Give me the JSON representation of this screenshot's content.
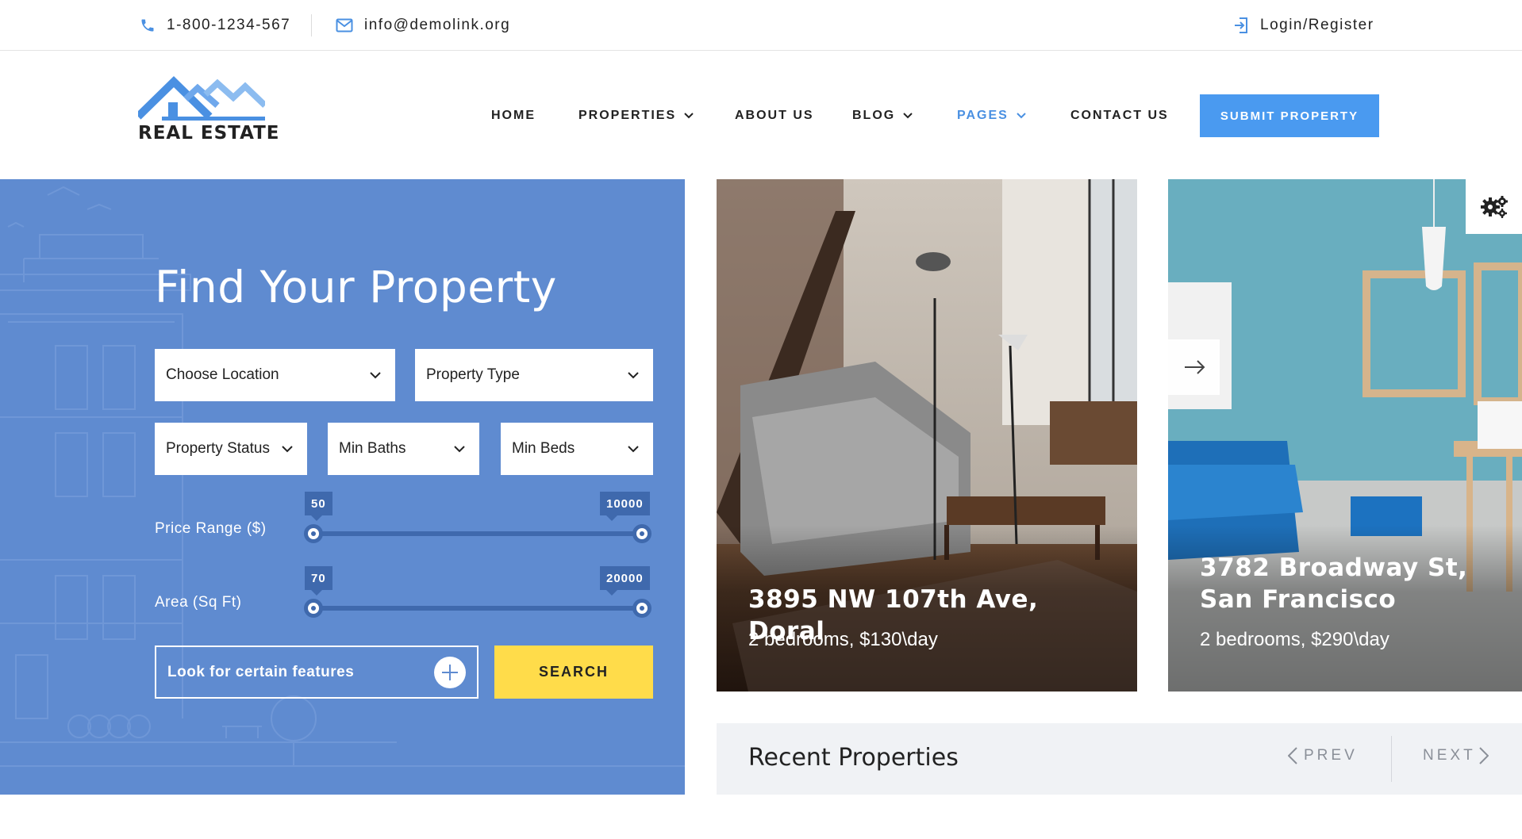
{
  "topbar": {
    "phone": "1-800-1234-567",
    "email": "info@demolink.org",
    "login": "Login/Register"
  },
  "brand": {
    "logo_text": "REAL ESTATE"
  },
  "nav": {
    "items": [
      {
        "label": "HOME",
        "dropdown": false
      },
      {
        "label": "PROPERTIES",
        "dropdown": true
      },
      {
        "label": "ABOUT US",
        "dropdown": false
      },
      {
        "label": "BLOG",
        "dropdown": true
      },
      {
        "label": "PAGES",
        "dropdown": true,
        "active": true
      },
      {
        "label": "CONTACT US",
        "dropdown": false
      }
    ],
    "cta": "SUBMIT PROPERTY"
  },
  "search": {
    "title": "Find Your Property",
    "location": "Choose Location",
    "type": "Property Type",
    "status": "Property Status",
    "baths": "Min Baths",
    "beds": "Min Beds",
    "price": {
      "label": "Price Range ($)",
      "min": "50",
      "max": "10000"
    },
    "area": {
      "label": "Area (Sq Ft)",
      "min": "70",
      "max": "20000"
    },
    "features": "Look for certain features",
    "button": "SEARCH"
  },
  "properties": [
    {
      "title": "3895 NW 107th Ave, Doral",
      "details": "2 bedrooms, $130\\day"
    },
    {
      "title": "3782 Broadway St, San Francisco",
      "details": "2 bedrooms, $290\\day"
    }
  ],
  "recent": {
    "title": "Recent Properties",
    "prev": "PREV",
    "next": "NEXT"
  },
  "colors": {
    "accent": "#4a9af0",
    "panel": "#5f8bd0",
    "search_button": "#ffdc4a"
  }
}
